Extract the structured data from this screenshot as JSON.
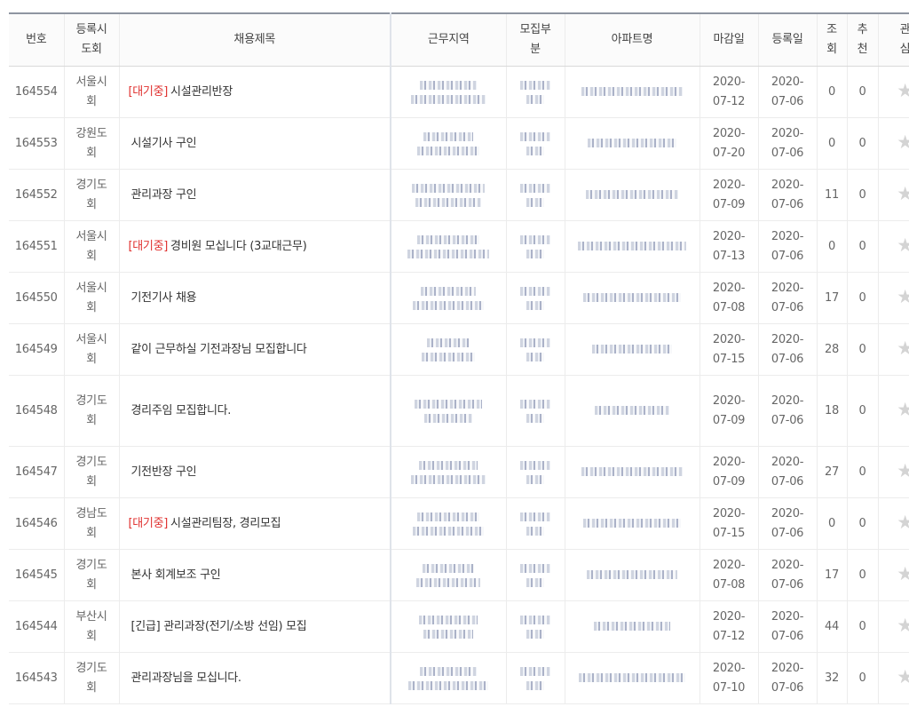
{
  "headers": {
    "no": "번호",
    "province": "등록시\n도회",
    "title": "채용제목",
    "region": "근무지역",
    "dept": "모집부\n분",
    "apt": "아파트명",
    "deadline": "마감일",
    "registered": "등록일",
    "views": "조\n회",
    "recommend": "추\n천",
    "interest": "관\n심"
  },
  "rows": [
    {
      "no": "164554",
      "province": "서울시\n회",
      "status": "[대기중]",
      "title": "시설관리반장",
      "deadline": "2020-\n07-12",
      "registered": "2020-\n07-06",
      "views": "0",
      "recommend": "0"
    },
    {
      "no": "164553",
      "province": "강원도\n회",
      "status": "",
      "title": "시설기사 구인",
      "deadline": "2020-\n07-20",
      "registered": "2020-\n07-06",
      "views": "0",
      "recommend": "0"
    },
    {
      "no": "164552",
      "province": "경기도\n회",
      "status": "",
      "title": "관리과장 구인",
      "deadline": "2020-\n07-09",
      "registered": "2020-\n07-06",
      "views": "11",
      "recommend": "0"
    },
    {
      "no": "164551",
      "province": "서울시\n회",
      "status": "[대기중]",
      "title": "경비원 모십니다 (3교대근무)",
      "deadline": "2020-\n07-13",
      "registered": "2020-\n07-06",
      "views": "0",
      "recommend": "0"
    },
    {
      "no": "164550",
      "province": "서울시\n회",
      "status": "",
      "title": "기전기사 채용",
      "deadline": "2020-\n07-08",
      "registered": "2020-\n07-06",
      "views": "17",
      "recommend": "0"
    },
    {
      "no": "164549",
      "province": "서울시\n회",
      "status": "",
      "title": "같이 근무하실 기전과장님 모집합니다",
      "deadline": "2020-\n07-15",
      "registered": "2020-\n07-06",
      "views": "28",
      "recommend": "0"
    },
    {
      "no": "164548",
      "province": "경기도\n회",
      "status": "",
      "title": "경리주임 모집합니다.",
      "deadline": "2020-\n07-09",
      "registered": "2020-\n07-06",
      "views": "18",
      "recommend": "0"
    },
    {
      "no": "164547",
      "province": "경기도\n회",
      "status": "",
      "title": "기전반장 구인",
      "deadline": "2020-\n07-09",
      "registered": "2020-\n07-06",
      "views": "27",
      "recommend": "0"
    },
    {
      "no": "164546",
      "province": "경남도\n회",
      "status": "[대기중]",
      "title": "시설관리팀장, 경리모집",
      "deadline": "2020-\n07-15",
      "registered": "2020-\n07-06",
      "views": "0",
      "recommend": "0"
    },
    {
      "no": "164545",
      "province": "경기도\n회",
      "status": "",
      "title": "본사 회계보조 구인",
      "deadline": "2020-\n07-08",
      "registered": "2020-\n07-06",
      "views": "17",
      "recommend": "0"
    },
    {
      "no": "164544",
      "province": "부산시\n회",
      "status": "",
      "title": "[긴급] 관리과장(전기/소방 선임) 모집",
      "deadline": "2020-\n07-12",
      "registered": "2020-\n07-06",
      "views": "44",
      "recommend": "0"
    },
    {
      "no": "164543",
      "province": "경기도\n회",
      "status": "",
      "title": "관리과장님을 모십니다.",
      "deadline": "2020-\n07-10",
      "registered": "2020-\n07-06",
      "views": "32",
      "recommend": "0"
    }
  ],
  "icons": {
    "interest": "star-icon"
  },
  "colors": {
    "status": "#e0312f",
    "header_border": "#8e95a1"
  }
}
